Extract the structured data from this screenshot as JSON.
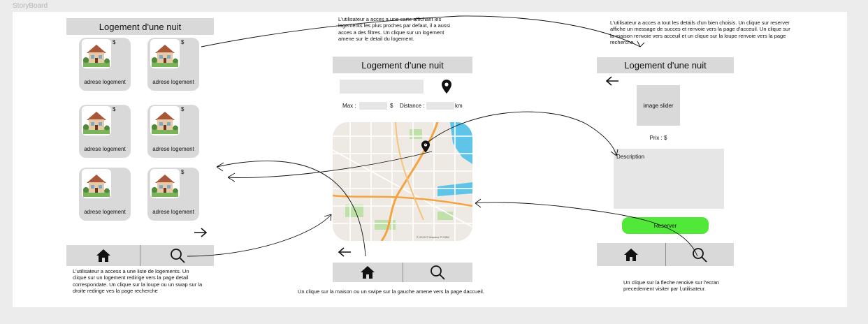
{
  "page": {
    "title": "StoryBoard"
  },
  "screen1": {
    "header": "Logement d'une nuit",
    "card_price": "$",
    "cards": [
      {
        "label": "adrese logement"
      },
      {
        "label": "adrese logement"
      },
      {
        "label": "adrese logement"
      },
      {
        "label": "adrese logement"
      },
      {
        "label": "adrese logement"
      },
      {
        "label": "adrese logement"
      }
    ],
    "note": "L'utilisateur a access a une liste de logements. Un clique sur un logement redirige vers la page detail correspondate. Un clique sur la loupe ou un swap sur la droite redirige ves la page recherche"
  },
  "screen2": {
    "note_top": "L'utilisateur a acces a une carte affichant les logements les plus proches par defaut, il a aussi acces a des filtres. Un clique sur un logement amene sur le detail du logement.",
    "header": "Logement d'une nuit",
    "max_label": "Max :",
    "currency": "$",
    "distance_label": "Distance :",
    "distance_unit": "km",
    "map_credit": "© 2019 © Mapbox © OSM",
    "note_bottom": "Un clique sur la maison ou un swipe sur la gauche amene vers la page daccueil."
  },
  "screen3": {
    "note_top": "L'utilisateur a acces a tout les  details d'un bien choisis. Un clique sur reserver affiche un message de succes et renvoie vers la page d'acceuil. Un clique sur la maison renvoie vers acceuil et un clique sur la loupe renvoie vers la page recherche.",
    "header": "Logement d'une nuit",
    "image_slider": "image slider",
    "price": "Prix : $",
    "description": "Description",
    "reserve_label": "Reserver",
    "note_bottom": "Un clique sur la fleche renoive sur l'ecran precedement visiter par l,utilisateur."
  },
  "colors": {
    "panel": "#d9d9d9",
    "reserve": "#52e83a",
    "map_water": "#5ec4e8",
    "map_road": "#f4a340",
    "map_park": "#bfe0a8"
  },
  "icons": [
    "house-icon",
    "search-icon",
    "location-pin-icon",
    "arrow-left-icon",
    "arrow-right-icon",
    "house-thumbnail-icon"
  ]
}
